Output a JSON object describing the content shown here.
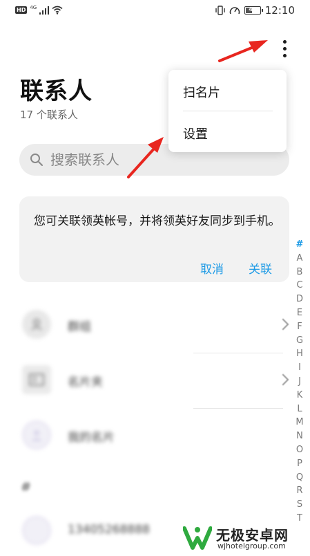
{
  "status_bar": {
    "hd": "HD",
    "network": "4G",
    "battery": "49",
    "battery_level": 0.49,
    "time": "12:10"
  },
  "header": {
    "title": "联系人",
    "count": "17 个联系人"
  },
  "search": {
    "placeholder": "搜索联系人"
  },
  "card": {
    "message": "您可关联领英帐号，并将领英好友同步到手机。",
    "cancel_label": "取消",
    "link_label": "关联"
  },
  "list": {
    "items": [
      {
        "label": "群组",
        "icon": "group-icon"
      },
      {
        "label": "名片夹",
        "icon": "card-holder-icon"
      },
      {
        "label": "我的名片",
        "icon": "profile-icon"
      }
    ],
    "section": "#",
    "contact": "13405268888"
  },
  "index_bar": [
    "#",
    "A",
    "B",
    "C",
    "D",
    "E",
    "F",
    "G",
    "H",
    "I",
    "J",
    "K",
    "L",
    "M",
    "N",
    "O",
    "P",
    "Q",
    "R",
    "S",
    "T"
  ],
  "menu": {
    "items": [
      {
        "label": "扫名片"
      },
      {
        "label": "设置"
      }
    ]
  },
  "watermark": {
    "name": "无极安卓网",
    "url": "wjhotelgroup.com"
  },
  "colors": {
    "accent": "#1e9be6",
    "annotation_arrow": "#e8261f"
  }
}
